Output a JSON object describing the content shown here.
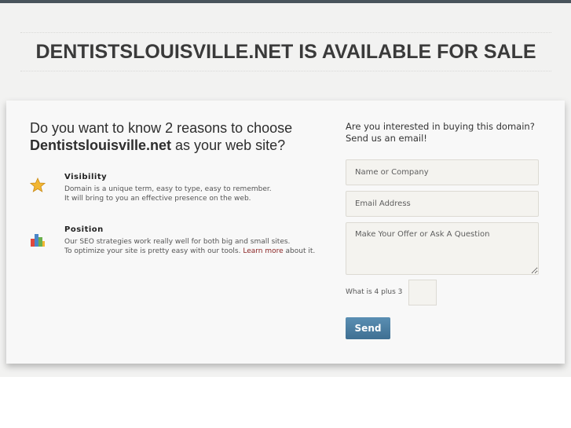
{
  "header": {
    "domain": "DENTISTSLOUISVILLE.NET",
    "headline_suffix": " IS AVAILABLE FOR SALE"
  },
  "left": {
    "lead_prefix": "Do you want to know 2 reasons to choose ",
    "lead_domain": "Dentistslouisville.net",
    "lead_suffix": " as your web site?",
    "features": [
      {
        "icon": "star-icon",
        "title": "Visibility",
        "line1": "Domain is a unique term, easy to type, easy to remember.",
        "line2": "It will bring to you an effective presence on the web."
      },
      {
        "icon": "bar-chart-icon",
        "title": "Position",
        "line1": "Our SEO strategies work really well for both big and small sites.",
        "line2_prefix": "To optimize your site is pretty easy with our tools. ",
        "link": "Learn more",
        "line2_suffix": " about it."
      }
    ]
  },
  "form": {
    "intro": "Are you interested in buying this domain? Send us an email!",
    "name_placeholder": "Name or Company",
    "email_placeholder": "Email Address",
    "message_placeholder": "Make Your Offer or Ask A Question",
    "captcha_question": "What is 4 plus 3",
    "captcha_value": "",
    "send_label": "Send"
  },
  "colors": {
    "topbar": "#49545c",
    "button": "#4a7a9d",
    "link": "#8a2424"
  }
}
